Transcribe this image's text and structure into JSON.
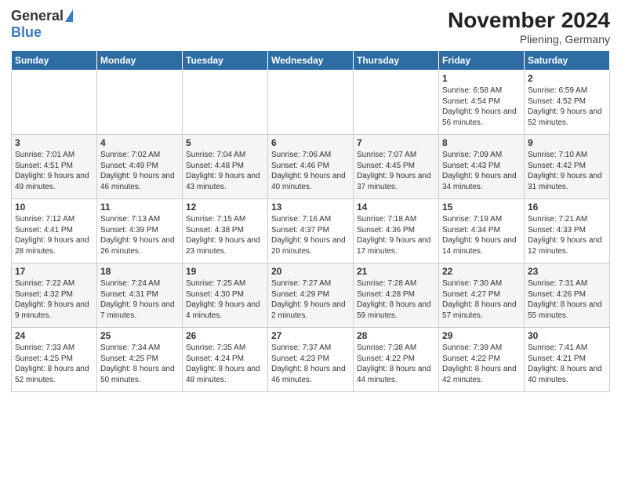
{
  "header": {
    "logo_general": "General",
    "logo_blue": "Blue",
    "title": "November 2024",
    "location": "Pliening, Germany"
  },
  "days_of_week": [
    "Sunday",
    "Monday",
    "Tuesday",
    "Wednesday",
    "Thursday",
    "Friday",
    "Saturday"
  ],
  "weeks": [
    [
      {
        "day": "",
        "info": ""
      },
      {
        "day": "",
        "info": ""
      },
      {
        "day": "",
        "info": ""
      },
      {
        "day": "",
        "info": ""
      },
      {
        "day": "",
        "info": ""
      },
      {
        "day": "1",
        "info": "Sunrise: 6:58 AM\nSunset: 4:54 PM\nDaylight: 9 hours and 56 minutes."
      },
      {
        "day": "2",
        "info": "Sunrise: 6:59 AM\nSunset: 4:52 PM\nDaylight: 9 hours and 52 minutes."
      }
    ],
    [
      {
        "day": "3",
        "info": "Sunrise: 7:01 AM\nSunset: 4:51 PM\nDaylight: 9 hours and 49 minutes."
      },
      {
        "day": "4",
        "info": "Sunrise: 7:02 AM\nSunset: 4:49 PM\nDaylight: 9 hours and 46 minutes."
      },
      {
        "day": "5",
        "info": "Sunrise: 7:04 AM\nSunset: 4:48 PM\nDaylight: 9 hours and 43 minutes."
      },
      {
        "day": "6",
        "info": "Sunrise: 7:06 AM\nSunset: 4:46 PM\nDaylight: 9 hours and 40 minutes."
      },
      {
        "day": "7",
        "info": "Sunrise: 7:07 AM\nSunset: 4:45 PM\nDaylight: 9 hours and 37 minutes."
      },
      {
        "day": "8",
        "info": "Sunrise: 7:09 AM\nSunset: 4:43 PM\nDaylight: 9 hours and 34 minutes."
      },
      {
        "day": "9",
        "info": "Sunrise: 7:10 AM\nSunset: 4:42 PM\nDaylight: 9 hours and 31 minutes."
      }
    ],
    [
      {
        "day": "10",
        "info": "Sunrise: 7:12 AM\nSunset: 4:41 PM\nDaylight: 9 hours and 28 minutes."
      },
      {
        "day": "11",
        "info": "Sunrise: 7:13 AM\nSunset: 4:39 PM\nDaylight: 9 hours and 26 minutes."
      },
      {
        "day": "12",
        "info": "Sunrise: 7:15 AM\nSunset: 4:38 PM\nDaylight: 9 hours and 23 minutes."
      },
      {
        "day": "13",
        "info": "Sunrise: 7:16 AM\nSunset: 4:37 PM\nDaylight: 9 hours and 20 minutes."
      },
      {
        "day": "14",
        "info": "Sunrise: 7:18 AM\nSunset: 4:36 PM\nDaylight: 9 hours and 17 minutes."
      },
      {
        "day": "15",
        "info": "Sunrise: 7:19 AM\nSunset: 4:34 PM\nDaylight: 9 hours and 14 minutes."
      },
      {
        "day": "16",
        "info": "Sunrise: 7:21 AM\nSunset: 4:33 PM\nDaylight: 9 hours and 12 minutes."
      }
    ],
    [
      {
        "day": "17",
        "info": "Sunrise: 7:22 AM\nSunset: 4:32 PM\nDaylight: 9 hours and 9 minutes."
      },
      {
        "day": "18",
        "info": "Sunrise: 7:24 AM\nSunset: 4:31 PM\nDaylight: 9 hours and 7 minutes."
      },
      {
        "day": "19",
        "info": "Sunrise: 7:25 AM\nSunset: 4:30 PM\nDaylight: 9 hours and 4 minutes."
      },
      {
        "day": "20",
        "info": "Sunrise: 7:27 AM\nSunset: 4:29 PM\nDaylight: 9 hours and 2 minutes."
      },
      {
        "day": "21",
        "info": "Sunrise: 7:28 AM\nSunset: 4:28 PM\nDaylight: 8 hours and 59 minutes."
      },
      {
        "day": "22",
        "info": "Sunrise: 7:30 AM\nSunset: 4:27 PM\nDaylight: 8 hours and 57 minutes."
      },
      {
        "day": "23",
        "info": "Sunrise: 7:31 AM\nSunset: 4:26 PM\nDaylight: 8 hours and 55 minutes."
      }
    ],
    [
      {
        "day": "24",
        "info": "Sunrise: 7:33 AM\nSunset: 4:25 PM\nDaylight: 8 hours and 52 minutes."
      },
      {
        "day": "25",
        "info": "Sunrise: 7:34 AM\nSunset: 4:25 PM\nDaylight: 8 hours and 50 minutes."
      },
      {
        "day": "26",
        "info": "Sunrise: 7:35 AM\nSunset: 4:24 PM\nDaylight: 8 hours and 48 minutes."
      },
      {
        "day": "27",
        "info": "Sunrise: 7:37 AM\nSunset: 4:23 PM\nDaylight: 8 hours and 46 minutes."
      },
      {
        "day": "28",
        "info": "Sunrise: 7:38 AM\nSunset: 4:22 PM\nDaylight: 8 hours and 44 minutes."
      },
      {
        "day": "29",
        "info": "Sunrise: 7:39 AM\nSunset: 4:22 PM\nDaylight: 8 hours and 42 minutes."
      },
      {
        "day": "30",
        "info": "Sunrise: 7:41 AM\nSunset: 4:21 PM\nDaylight: 8 hours and 40 minutes."
      }
    ]
  ]
}
